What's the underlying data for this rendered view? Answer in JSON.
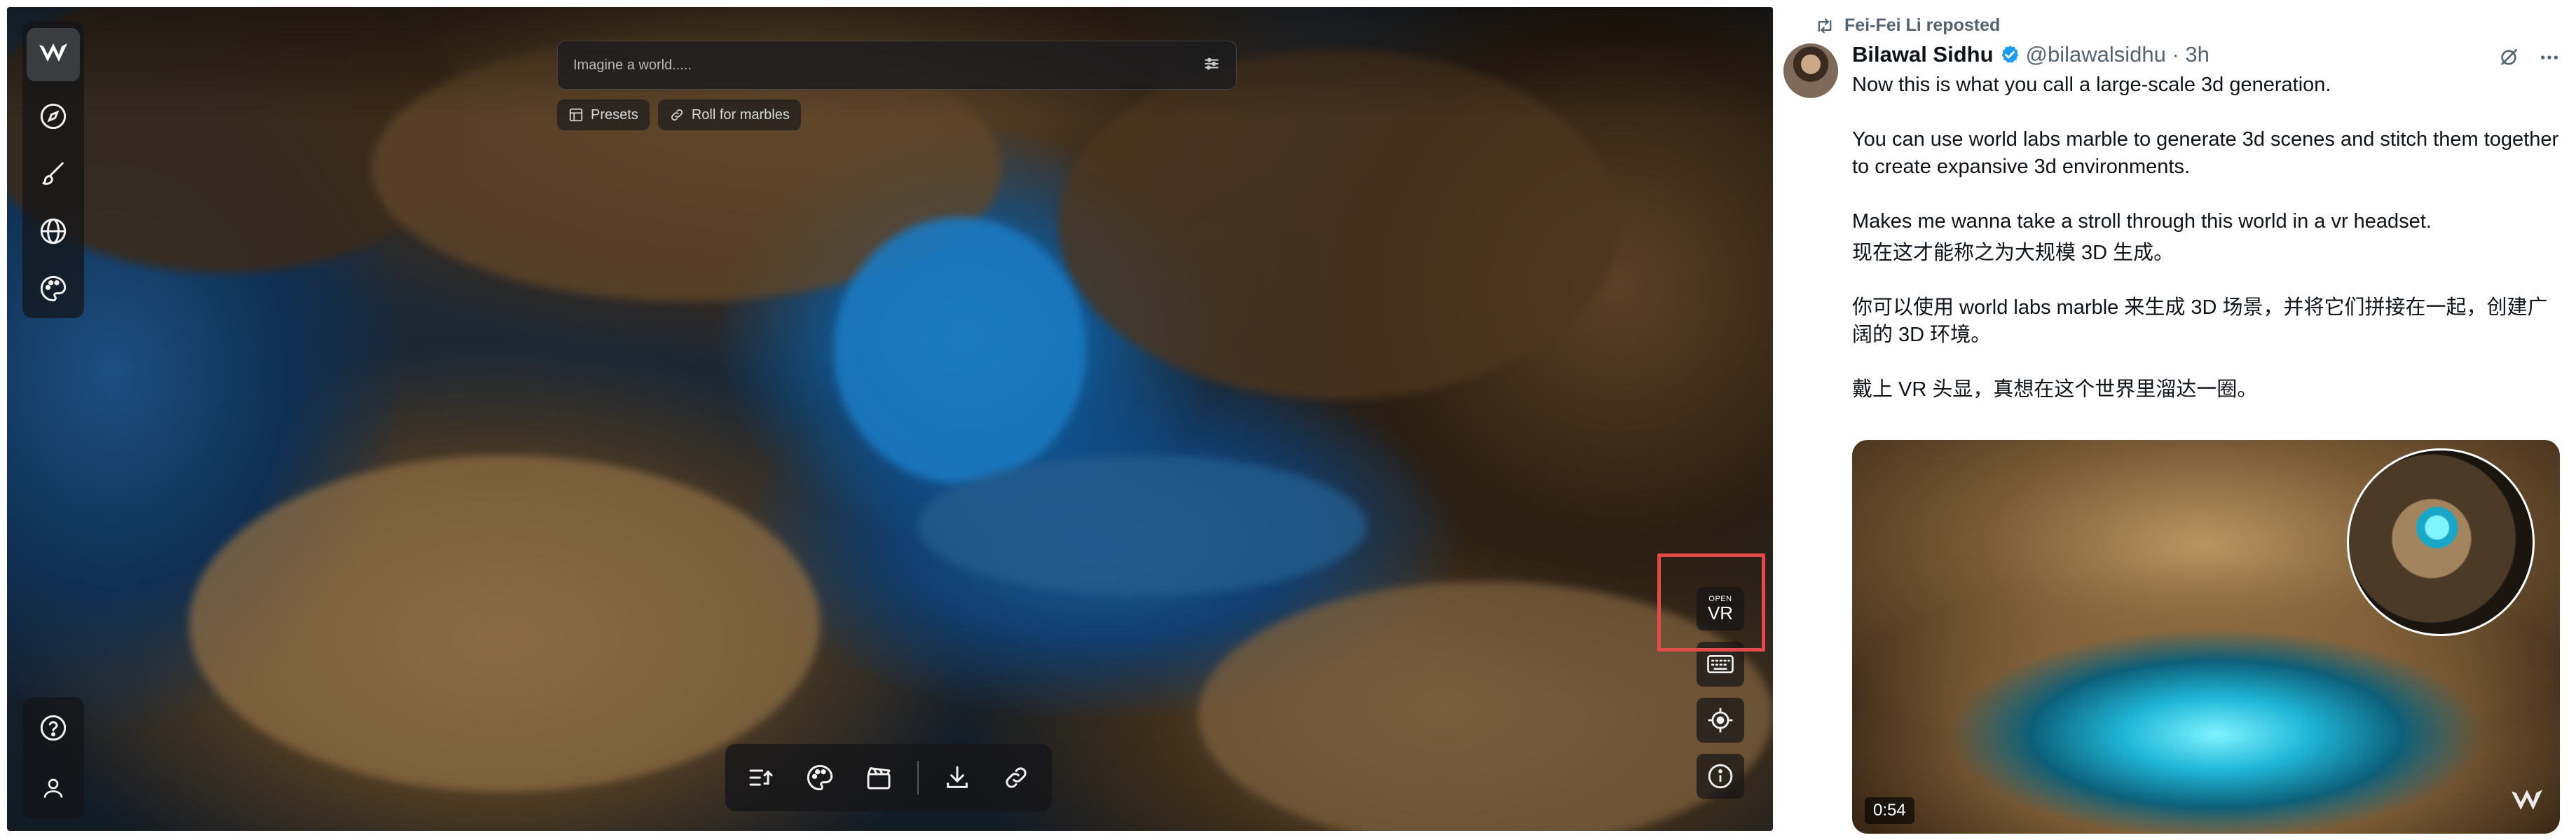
{
  "viewer": {
    "prompt": {
      "placeholder": "Imagine a world.....",
      "value": ""
    },
    "chips": [
      {
        "label": "Presets",
        "icon": "layout-icon"
      },
      {
        "label": "Roll for marbles",
        "icon": "link-icon"
      }
    ],
    "left_toolbar": [
      "compass-icon",
      "brush-icon",
      "globe-icon",
      "palette-icon"
    ],
    "bottom_left_toolbar": [
      "help-icon",
      "user-icon"
    ],
    "right_tools": {
      "vr_small": "OPEN",
      "vr_big": "VR",
      "others": [
        "keyboard-icon",
        "crosshair-icon",
        "info-icon"
      ]
    },
    "bottom_bar": [
      "list-icon",
      "palette-icon",
      "clapper-icon",
      "download-icon",
      "link-icon"
    ],
    "highlight_color": "#e34b4b"
  },
  "post": {
    "repost_text": "Fei-Fei Li reposted",
    "author_name": "Bilawal Sidhu",
    "handle_time": "@bilawalsidhu · 3h",
    "paragraphs": [
      "Now this is what you call a large-scale 3d generation.",
      "",
      "You can use world labs marble to generate 3d scenes and stitch them together to create expansive 3d environments.",
      "",
      "Makes me wanna take a stroll through this world in a vr headset.",
      "现在这才能称之为大规模 3D 生成。",
      "",
      "你可以使用 world labs marble 来生成 3D 场景，并将它们拼接在一起，创建广阔的 3D 环境。",
      "",
      "戴上 VR 头显，真想在这个世界里溜达一圈。"
    ],
    "video_duration": "0:54",
    "verified_color": "#1d9bf0"
  }
}
